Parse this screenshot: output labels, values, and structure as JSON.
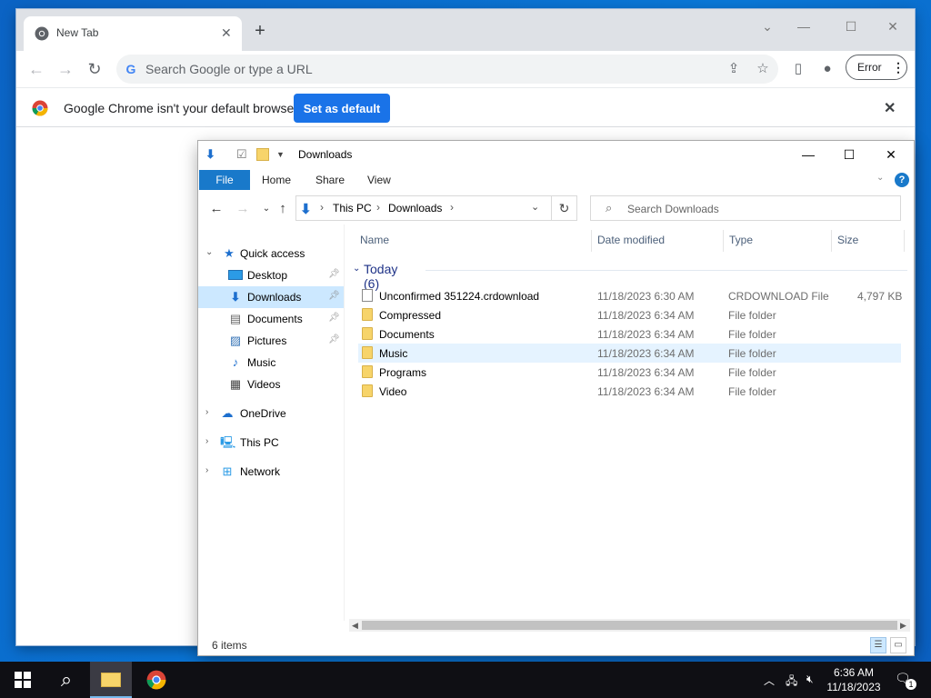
{
  "colors": {
    "accent": "#1a73e8",
    "explorer_accent": "#1979ca",
    "selection": "#cce8ff",
    "hover": "#e5f3ff",
    "folder": "#f7d46a"
  },
  "chrome": {
    "tab_title": "New Tab",
    "omnibox_placeholder": "Search Google or type a URL",
    "profile_label": "Error",
    "infobar_message": "Google Chrome isn't your default browser",
    "set_default_label": "Set as default"
  },
  "explorer": {
    "title": "Downloads",
    "ribbon_tabs": [
      "File",
      "Home",
      "Share",
      "View"
    ],
    "breadcrumb": [
      "This PC",
      "Downloads"
    ],
    "search_placeholder": "Search Downloads",
    "nav": {
      "quick_access": "Quick access",
      "items": [
        "Desktop",
        "Downloads",
        "Documents",
        "Pictures",
        "Music",
        "Videos"
      ],
      "onedrive": "OneDrive",
      "this_pc": "This PC",
      "network": "Network"
    },
    "columns": [
      "Name",
      "Date modified",
      "Type",
      "Size"
    ],
    "group_label": "Today (6)",
    "files": [
      {
        "name": "Unconfirmed 351224.crdownload",
        "date": "11/18/2023 6:30 AM",
        "type": "CRDOWNLOAD File",
        "size": "4,797 KB",
        "kind": "file"
      },
      {
        "name": "Compressed",
        "date": "11/18/2023 6:34 AM",
        "type": "File folder",
        "size": "",
        "kind": "folder"
      },
      {
        "name": "Documents",
        "date": "11/18/2023 6:34 AM",
        "type": "File folder",
        "size": "",
        "kind": "folder"
      },
      {
        "name": "Music",
        "date": "11/18/2023 6:34 AM",
        "type": "File folder",
        "size": "",
        "kind": "folder"
      },
      {
        "name": "Programs",
        "date": "11/18/2023 6:34 AM",
        "type": "File folder",
        "size": "",
        "kind": "folder"
      },
      {
        "name": "Video",
        "date": "11/18/2023 6:34 AM",
        "type": "File folder",
        "size": "",
        "kind": "folder"
      }
    ],
    "status_count": "6 items"
  },
  "taskbar": {
    "time": "6:36 AM",
    "date": "11/18/2023",
    "notification_count": "1"
  }
}
